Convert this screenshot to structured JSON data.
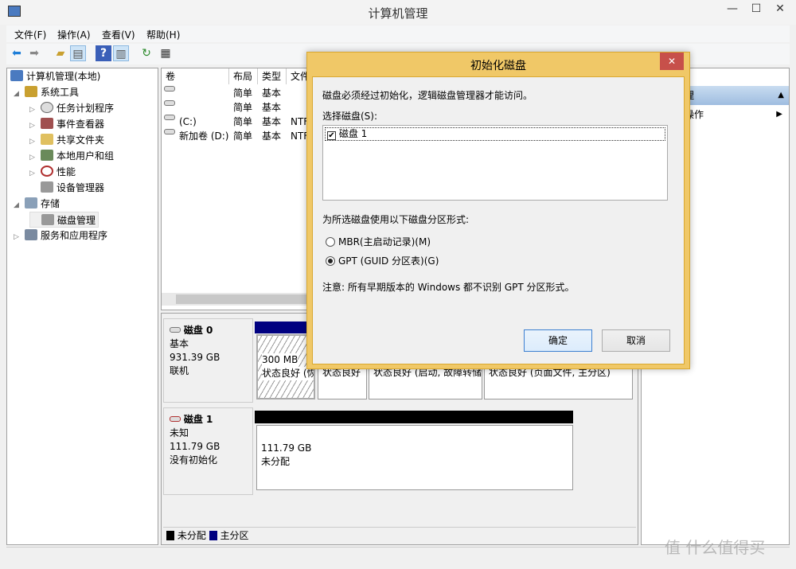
{
  "window": {
    "title": "计算机管理",
    "minimize": "—",
    "maximize": "☐",
    "close": "✕"
  },
  "menu": [
    "文件(F)",
    "操作(A)",
    "查看(V)",
    "帮助(H)"
  ],
  "toolbar": [
    "back-icon",
    "forward-icon",
    "up-folder-icon",
    "show-hide-tree-icon",
    "help-icon",
    "show-hide-action-icon",
    "refresh-icon",
    "properties-icon"
  ],
  "tree": {
    "root": "计算机管理(本地)",
    "items": [
      {
        "label": "系统工具",
        "level": 1,
        "expanded": true
      },
      {
        "label": "任务计划程序",
        "level": 2
      },
      {
        "label": "事件查看器",
        "level": 2
      },
      {
        "label": "共享文件夹",
        "level": 2
      },
      {
        "label": "本地用户和组",
        "level": 2
      },
      {
        "label": "性能",
        "level": 2
      },
      {
        "label": "设备管理器",
        "level": 2
      },
      {
        "label": "存储",
        "level": 1,
        "expanded": true
      },
      {
        "label": "磁盘管理",
        "level": 2,
        "selected": true
      },
      {
        "label": "服务和应用程序",
        "level": 1
      }
    ]
  },
  "volumes": {
    "columns": [
      "卷",
      "布局",
      "类型",
      "文件"
    ],
    "rows": [
      [
        "",
        "简单",
        "基本",
        ""
      ],
      [
        "",
        "简单",
        "基本",
        ""
      ],
      [
        "(C:)",
        "简单",
        "基本",
        "NTF"
      ],
      [
        "新加卷 (D:)",
        "简单",
        "基本",
        "NTF"
      ]
    ]
  },
  "disks": [
    {
      "name": "磁盘 0",
      "type": "基本",
      "size": "931.39 GB",
      "status": "联机",
      "partitions": [
        {
          "size": "300 MB",
          "status": "状态良好 (恢"
        },
        {
          "size": "",
          "status": "状态良好"
        },
        {
          "size": "",
          "status": "状态良好 (启动, 故障转储"
        },
        {
          "size": "",
          "status": "状态良好 (页面文件, 主分区)"
        }
      ]
    },
    {
      "name": "磁盘 1",
      "type": "未知",
      "size": "111.79 GB",
      "status": "没有初始化",
      "partitions": [
        {
          "size": "111.79 GB",
          "status": "未分配"
        }
      ]
    }
  ],
  "legend": {
    "unallocated": "未分配",
    "primary": "主分区",
    "colors": {
      "unallocated": "#000000",
      "primary": "#000080"
    }
  },
  "actions": {
    "header": "理",
    "item": "操作"
  },
  "dialog": {
    "title": "初始化磁盘",
    "message": "磁盘必须经过初始化，逻辑磁盘管理器才能访问。",
    "select_label": "选择磁盘(S):",
    "disk_item": "磁盘 1",
    "disk_checked": true,
    "style_label": "为所选磁盘使用以下磁盘分区形式:",
    "mbr": "MBR(主启动记录)(M)",
    "gpt": "GPT (GUID 分区表)(G)",
    "selected": "gpt",
    "note": "注意: 所有早期版本的 Windows 都不识别 GPT 分区形式。",
    "ok": "确定",
    "cancel": "取消",
    "close": "✕"
  },
  "watermark": "值 什么值得买"
}
